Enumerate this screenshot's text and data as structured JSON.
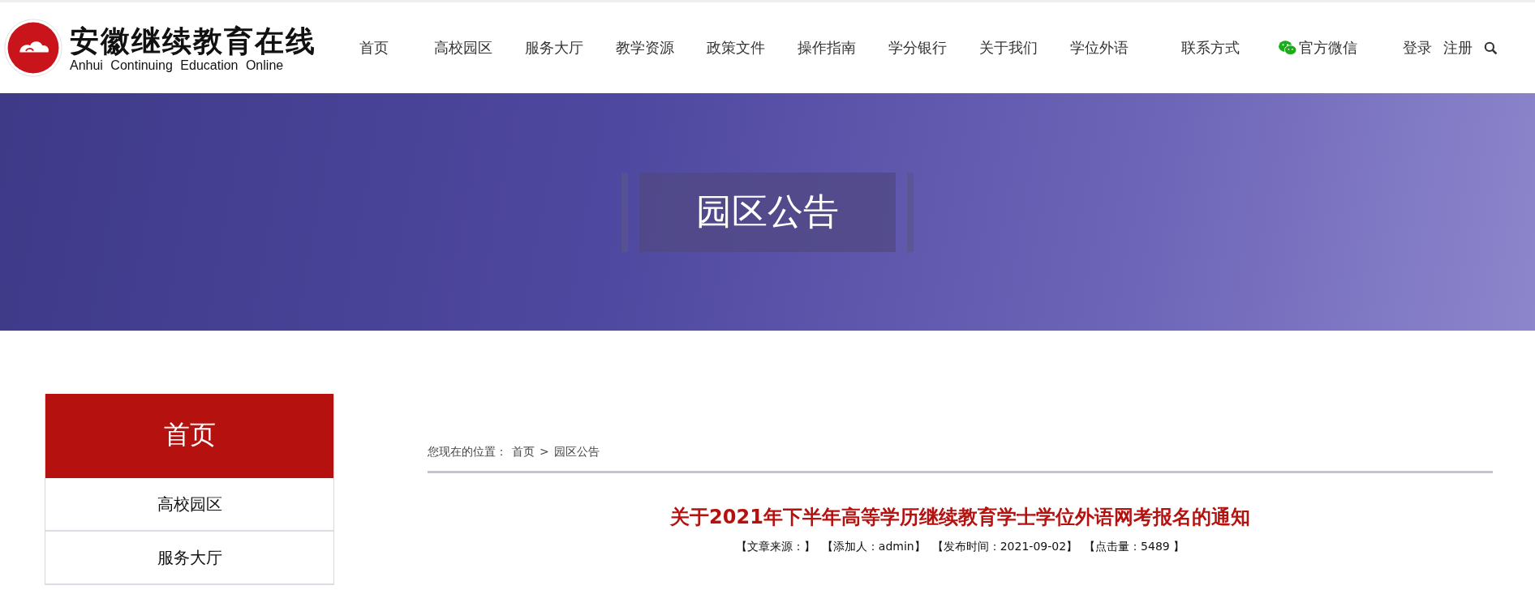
{
  "logo": {
    "title": "安徽继续教育在线",
    "subtitle": "Anhui Continuing Education Online"
  },
  "nav": [
    {
      "label": "首页",
      "kind": "link"
    },
    {
      "label": "高校园区",
      "kind": "link"
    },
    {
      "label": "服务大厅",
      "kind": "link"
    },
    {
      "label": "教学资源",
      "kind": "link"
    },
    {
      "label": "政策文件",
      "kind": "link"
    },
    {
      "label": "操作指南",
      "kind": "link"
    },
    {
      "label": "学分银行",
      "kind": "link"
    },
    {
      "label": "关于我们",
      "kind": "link"
    },
    {
      "label": "学位外语",
      "kind": "link"
    },
    {
      "label": "联系方式",
      "kind": "link"
    },
    {
      "label": "官方微信",
      "kind": "wechat"
    }
  ],
  "account": [
    "登录",
    "注册"
  ],
  "banner": {
    "title": "园区公告"
  },
  "sidebar": {
    "items": [
      {
        "label": "首页",
        "selected": true
      },
      {
        "label": "高校园区",
        "selected": false
      },
      {
        "label": "服务大厅",
        "selected": false
      }
    ]
  },
  "breadcrumb": {
    "prefix": "您现在的位置：",
    "items": [
      "首页",
      "园区公告"
    ],
    "separator": ">"
  },
  "article": {
    "title": "关于2021年下半年高等学历继续教育学士学位外语网考报名的通知",
    "meta": [
      "【文章来源：】",
      "【添加人：admin】",
      "【发布时间：2021-09-02】",
      "【点击量：5489 】"
    ]
  }
}
